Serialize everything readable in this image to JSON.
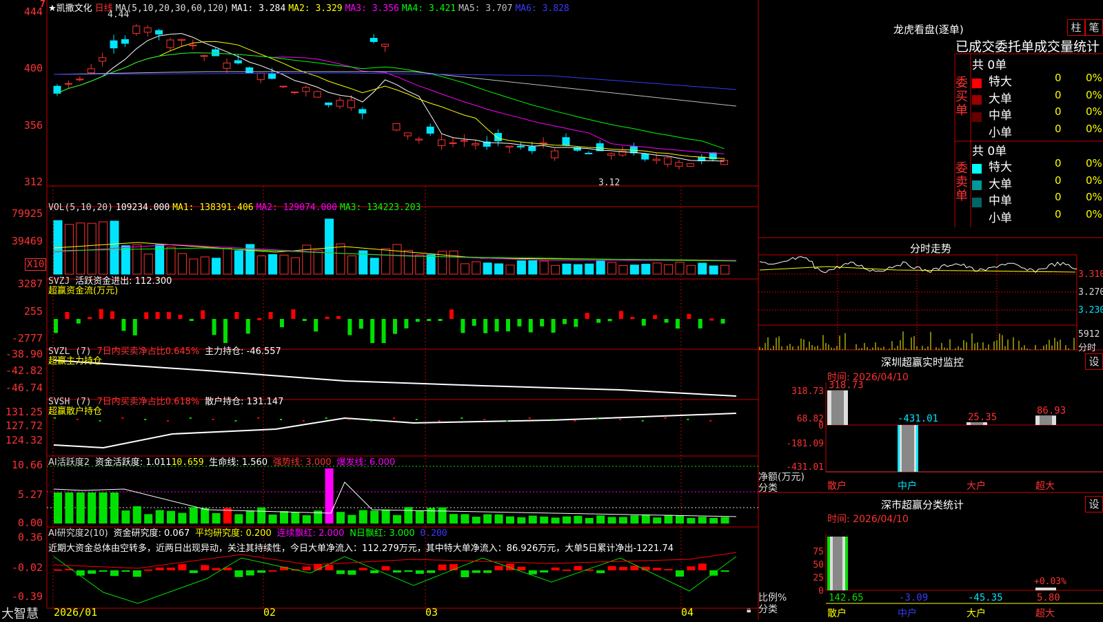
{
  "colors": {
    "up": "#ff3232",
    "down": "#00e5ff",
    "ma1": "#ffffff",
    "ma2": "#ffff00",
    "ma3": "#ff00ff",
    "ma4": "#00ff00",
    "ma5": "#c0c0c0",
    "ma6": "#3a3aff",
    "grid": "#c00000",
    "green": "#00e000",
    "red": "#ff0000"
  },
  "main": {
    "stock_name": "★凯撒文化",
    "period_label": "日线",
    "ma_title": "MA(5,10,20,30,60,120)",
    "ma1": "MA1: 3.284",
    "ma2": "MA2: 3.329",
    "ma3": "MA3: 3.356",
    "ma4": "MA4: 3.421",
    "ma5": "MA5: 3.707",
    "ma6": "MA6: 3.828",
    "high_mark": "4.44",
    "low_mark": "3.12",
    "y_labels": [
      "444",
      "400",
      "356",
      "312"
    ],
    "corner_badge": "7"
  },
  "vol": {
    "title": "VOL(5,10,20)",
    "value": "109234.000",
    "ma1": "MA1: 138391.406",
    "ma2": "MA2: 129074.000",
    "ma3": "MA3: 134223.203",
    "y_labels": [
      "79925",
      "39469"
    ],
    "unit": "X10"
  },
  "svzj": {
    "title": "SVZJ",
    "label": "活跃资金进出: 112.300",
    "subtitle": "超赢资金流(万元)",
    "y_labels": [
      "3287",
      "255",
      "-2777"
    ]
  },
  "svzl": {
    "title": "SVZL (7)",
    "pct": "7日内买卖净占比0.645%",
    "label": "主力持仓: -46.557",
    "subtitle": "超赢主力持仓",
    "y_labels": [
      "-38.90",
      "-42.82",
      "-46.74"
    ]
  },
  "svsh": {
    "title": "SVSH (7)",
    "pct": "7日内买卖净占比0.618%",
    "label": "散户持仓: 131.147",
    "subtitle": "超赢散户持仓",
    "y_labels": [
      "131.25",
      "127.72",
      "124.32"
    ]
  },
  "ai1": {
    "title": "AI活跃度2",
    "label": "资金活跃度: 1.011",
    "v2": "10.659",
    "life": "生命线: 1.560",
    "strong": "强势线: 3.000",
    "burst": "爆发线: 6.000",
    "y_labels": [
      "10.66",
      "5.27",
      "0.00"
    ]
  },
  "ai2": {
    "title": "AI研究度2(10)",
    "label": "资金研究度: 0.067",
    "avg": "平均研究度: 0.200",
    "lian": "连续飘红: 2.000",
    "nday": "N日飘红: 3.000",
    "last": "0.200",
    "y_labels": [
      "0.36",
      "-0.02",
      "-0.39"
    ],
    "comment": "近期大资金总体由空转多，近两日出现异动，关注其持续性，今日大单净流入：112.279万元，其中特大单净流入：86.926万元，大单5日累计净出-1221.74"
  },
  "x_axis": {
    "labels": [
      "2026/01",
      "02",
      "03",
      "04"
    ],
    "brand": "大智慧"
  },
  "right": {
    "header_title": "龙虎看盘(逐单)",
    "btn_zhu": "柱",
    "btn_bi": "笔",
    "stat_title": "已成交委托单成交量统计",
    "buy_label": "委买单",
    "sell_label": "委卖单",
    "buy_total": "共 0单",
    "sell_total": "共 0单",
    "buy_rows": [
      {
        "name": "特大",
        "count": "0",
        "pct": "0%",
        "color": "#ff0000"
      },
      {
        "name": "大单",
        "count": "0",
        "pct": "0%",
        "color": "#990000"
      },
      {
        "name": "中单",
        "count": "0",
        "pct": "0%",
        "color": "#660000"
      },
      {
        "name": "小单",
        "count": "0",
        "pct": "0%",
        "color": ""
      }
    ],
    "sell_rows": [
      {
        "name": "特大",
        "count": "0",
        "pct": "0%",
        "color": "#00ffff"
      },
      {
        "name": "大单",
        "count": "0",
        "pct": "0%",
        "color": "#009999"
      },
      {
        "name": "中单",
        "count": "0",
        "pct": "0%",
        "color": "#006666"
      },
      {
        "name": "小单",
        "count": "0",
        "pct": "0%",
        "color": ""
      }
    ],
    "minute_title": "分时走势",
    "minute_y": [
      "3.310",
      "3.270",
      "3.230"
    ],
    "minute_vol": "5912",
    "minute_vol_label": "分时",
    "sz_title": "深圳超赢实时监控",
    "sz_btn": "设",
    "sz_time": "时间: 2026/04/10",
    "sz_y": [
      "318.73",
      "68.82",
      "0",
      "-181.09",
      "-431.01"
    ],
    "sz_unit": "净额(万元)",
    "sz_cat_label": "分类",
    "sz_categories": [
      "散户",
      "中户",
      "大户",
      "超大"
    ],
    "sz_values": [
      "318.73",
      "-431.01",
      "25.35",
      "86.93"
    ],
    "sc_title": "深市超赢分类统计",
    "sc_btn": "设",
    "sc_time": "时间: 2026/04/10",
    "sc_y": [
      "75",
      "50",
      "25",
      "0"
    ],
    "sc_ratio": "比例%",
    "sc_cat_label": "分类",
    "sc_categories": [
      "散户",
      "中户",
      "大户",
      "超大"
    ],
    "sc_values": [
      "142.65",
      "-3.09",
      "-45.35",
      "5.80"
    ],
    "sc_top": "+0.03%"
  }
}
